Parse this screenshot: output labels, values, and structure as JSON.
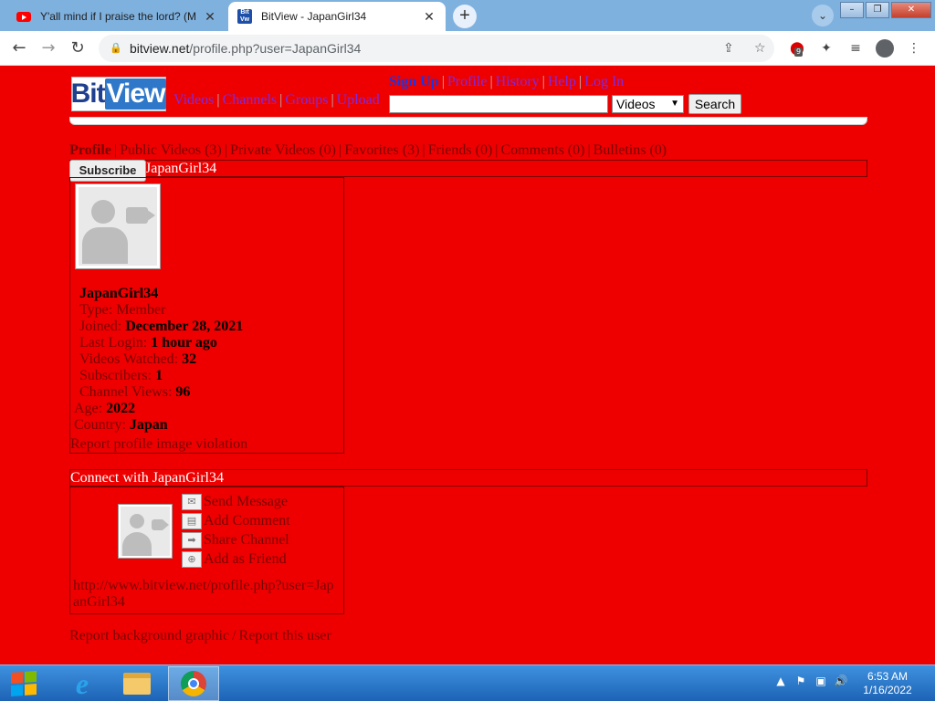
{
  "browser": {
    "tabs": [
      {
        "title": "Y'all mind if I praise the lord? (M",
        "icon": "youtube-icon"
      },
      {
        "title": "BitView - JapanGirl34",
        "icon": "bitview-icon"
      }
    ],
    "url_host": "bitview.net",
    "url_path": "/profile.php?user=JapanGirl34",
    "extension_badge": "9"
  },
  "site": {
    "logo_bit": "Bit",
    "logo_view": "View",
    "top_links": [
      "Sign Up",
      "Profile",
      "History",
      "Help",
      "Log In"
    ],
    "main_links": [
      "Videos",
      "Channels",
      "Groups",
      "Upload"
    ],
    "search": {
      "selected": "Videos",
      "button": "Search",
      "value": ""
    }
  },
  "profile_tabs": [
    "Profile",
    "Public Videos (3)",
    "Private Videos (0)",
    "Favorites (3)",
    "Friends (0)",
    "Comments (0)",
    "Bulletins (0)"
  ],
  "profile": {
    "header": "JapanGirl34",
    "subscribe": "Subscribe",
    "username": "JapanGirl34",
    "type_label": "Type:",
    "type": "Member",
    "joined_label": "Joined:",
    "joined": "December 28, 2021",
    "login_label": "Last Login:",
    "login": "1 hour ago",
    "watched_label": "Videos Watched:",
    "watched": "32",
    "subs_label": "Subscribers:",
    "subs": "1",
    "views_label": "Channel Views:",
    "views": "96",
    "age_label": "Age:",
    "age": "2022",
    "country_label": "Country:",
    "country": "Japan",
    "report_image": "Report profile image violation"
  },
  "connect": {
    "header": "Connect with JapanGirl34",
    "actions": [
      "Send Message",
      "Add Comment",
      "Share Channel",
      "Add as Friend"
    ],
    "url": "http://www.bitview.net/profile.php?user=JapanGirl34"
  },
  "footer_links": [
    "Report background graphic",
    "Report this user"
  ],
  "taskbar": {
    "time": "6:53 AM",
    "date": "1/16/2022"
  },
  "colors": {
    "page_bg": "#ee0000",
    "link": "#7d2be0",
    "signup": "#1d35e0",
    "text_dark_red": "#7a0000"
  }
}
